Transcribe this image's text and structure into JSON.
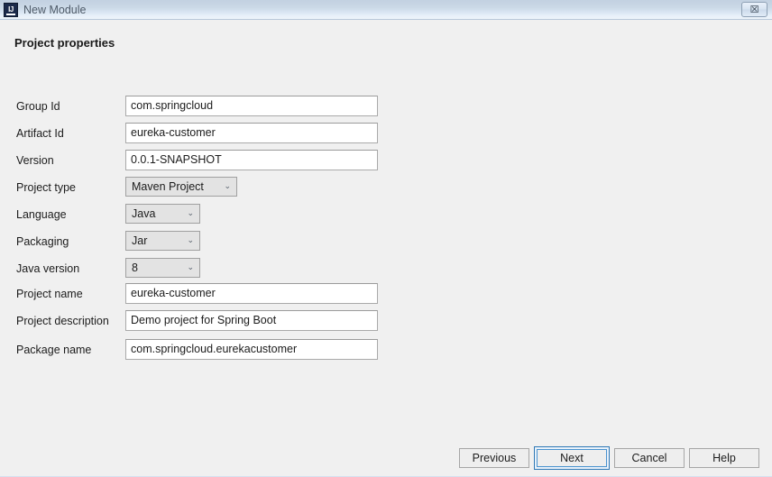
{
  "window": {
    "title": "New Module",
    "app_icon": "intellij-idea-icon",
    "close_label": "☒",
    "titlebar_gradient_top": "#c2d1e1",
    "titlebar_gradient_bottom": "#eef4fa",
    "background": "#f0f0f0"
  },
  "page": {
    "heading": "Project properties"
  },
  "form": {
    "fields": [
      {
        "label": "Group Id",
        "kind": "text",
        "value": "com.springcloud"
      },
      {
        "label": "Artifact Id",
        "kind": "text",
        "value": "eureka-customer"
      },
      {
        "label": "Version",
        "kind": "text",
        "value": "0.0.1-SNAPSHOT"
      },
      {
        "label": "Project type",
        "kind": "combo",
        "value": "Maven Project",
        "size": "wide"
      },
      {
        "label": "Language",
        "kind": "combo",
        "value": "Java",
        "size": "narrow"
      },
      {
        "label": "Packaging",
        "kind": "combo",
        "value": "Jar",
        "size": "narrow"
      },
      {
        "label": "Java version",
        "kind": "combo",
        "value": "8",
        "size": "narrow"
      },
      {
        "label": "Project name",
        "kind": "text",
        "value": "eureka-customer"
      },
      {
        "label": "Project description",
        "kind": "text",
        "value": "Demo project for Spring Boot"
      },
      {
        "label": "Package name",
        "kind": "text",
        "value": "com.springcloud.eurekacustomer"
      }
    ],
    "combo_arrow": "⌄"
  },
  "buttons": {
    "previous": "Previous",
    "next": "Next",
    "cancel": "Cancel",
    "help": "Help",
    "focus_color": "#2f78b5"
  }
}
